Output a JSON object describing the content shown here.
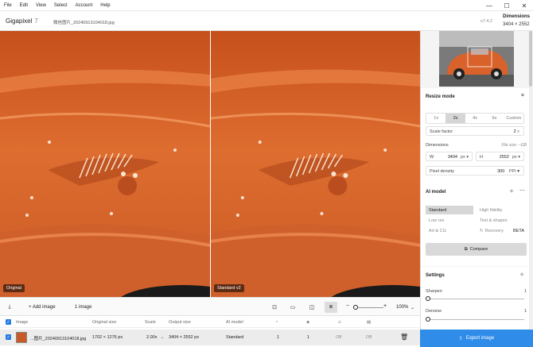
{
  "menu": [
    "File",
    "Edit",
    "View",
    "Select",
    "Account",
    "Help"
  ],
  "window_controls": {
    "minimize": "—",
    "maximize": "☐",
    "close": "✕"
  },
  "app": {
    "name": "Gigapixel",
    "version_num": "7",
    "filename": "微信图片_20240913104018.jpg",
    "version": "v7.4.2"
  },
  "dimensions_box": {
    "label": "Dimensions",
    "value": "3404 × 2552"
  },
  "preview": {
    "left_label": "Original",
    "right_label": "Standard v2"
  },
  "resize": {
    "title": "Resize mode",
    "scales": [
      "1x",
      "2x",
      "4x",
      "6x",
      "Custom"
    ],
    "active_scale": "2x",
    "scale_factor_label": "Scale factor",
    "scale_factor_value": "2",
    "scale_factor_unit": "x",
    "dimensions_label": "Dimensions",
    "file_size": "File size: --GB",
    "w_label": "W",
    "w_value": "3404",
    "w_unit": "px",
    "h_label": "H",
    "h_value": "2552",
    "h_unit": "px",
    "pixel_density_label": "Pixel density",
    "pixel_density_value": "300",
    "pixel_density_unit": "PPI"
  },
  "ai_model": {
    "title": "AI model",
    "models": [
      "Standard",
      "High fidelity",
      "Low res",
      "Text & shapes",
      "Art & CG",
      "Recovery"
    ],
    "active": "Standard",
    "beta": "BETA",
    "compare_label": "Compare"
  },
  "settings": {
    "title": "Settings",
    "sharpen_label": "Sharpen",
    "sharpen_value": "1",
    "denoise_label": "Denoise",
    "denoise_value": "1"
  },
  "toolbar": {
    "add_image": "Add image",
    "count": "1 image",
    "zoom": "100%"
  },
  "table": {
    "headers": [
      "Image",
      "Original size",
      "Scale",
      "Output size",
      "AI model"
    ],
    "row": {
      "name": "...图片_20240913104018.jpg",
      "original": "1702 × 1276 px",
      "scale": "2.00x",
      "arrow": "→",
      "output": "3404 × 2552 px",
      "model": "Standard",
      "v1": "1",
      "v2": "1",
      "v3": "Off",
      "v4": "Off"
    }
  },
  "export_label": "Export image",
  "colors": {
    "accent": "#2f8ce8",
    "car": "#d2622a"
  }
}
